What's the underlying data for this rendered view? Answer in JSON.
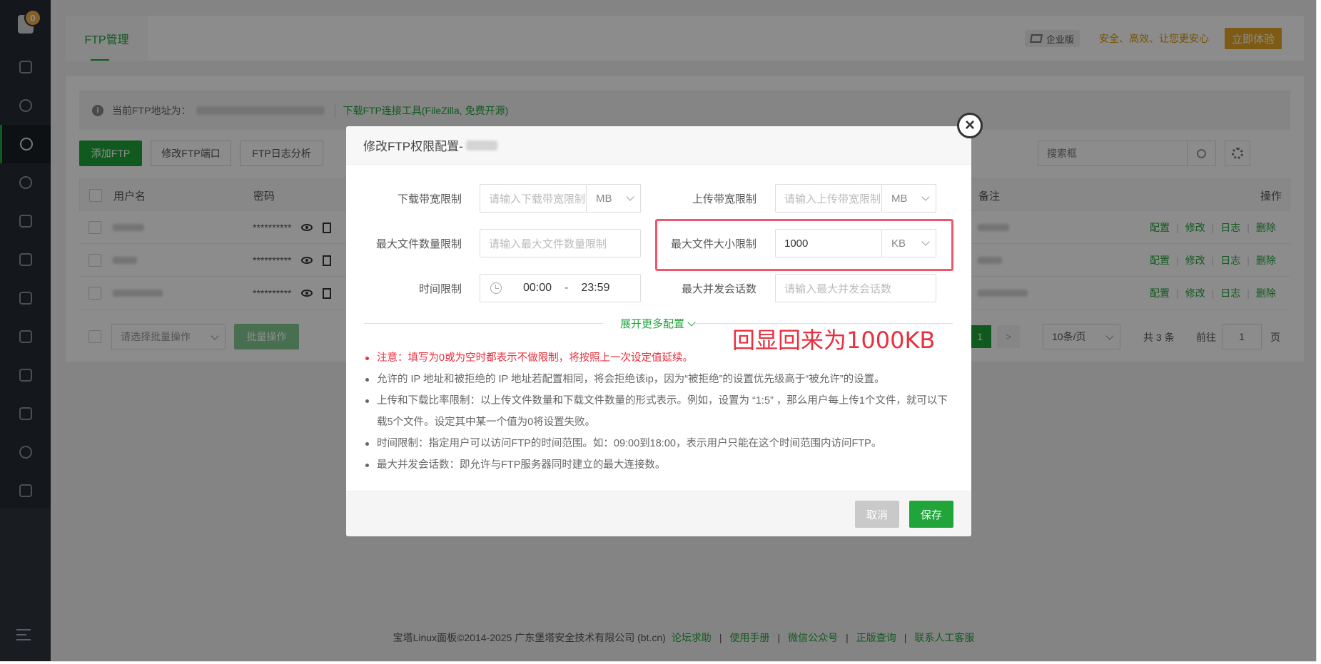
{
  "sidebar": {
    "badge_count": "0",
    "items": [
      {
        "icon": "home-icon"
      },
      {
        "icon": "globe-icon"
      },
      {
        "icon": "ftp-globe-icon",
        "active": true
      },
      {
        "icon": "database-icon"
      },
      {
        "icon": "save-icon"
      },
      {
        "icon": "shield-icon"
      },
      {
        "icon": "folder-icon"
      },
      {
        "icon": "log-icon"
      },
      {
        "icon": "calendar-icon"
      },
      {
        "icon": "apps-icon"
      },
      {
        "icon": "settings-icon"
      },
      {
        "icon": "logout-icon"
      }
    ]
  },
  "header": {
    "tab": "FTP管理",
    "edition": "企业版",
    "slogan": "安全、高效、让您更安心",
    "try_button": "立即体验"
  },
  "info_bar": {
    "label": "当前FTP地址为：",
    "link": "下载FTP连接工具(FileZilla, 免费开源)"
  },
  "toolbar": {
    "add": "添加FTP",
    "port": "修改FTP端口",
    "log": "FTP日志分析",
    "search_placeholder": "搜索框"
  },
  "table": {
    "headers": {
      "user": "用户名",
      "password": "密码",
      "note": "备注",
      "ops": "操作"
    },
    "rows": [
      {
        "password": "**********"
      },
      {
        "password": "**********"
      },
      {
        "password": "**********"
      }
    ],
    "ops": [
      "配置",
      "修改",
      "日志",
      "删除"
    ]
  },
  "batch": {
    "select_placeholder": "请选择批量操作",
    "button": "批量操作"
  },
  "pagination": {
    "current": "1",
    "next": ">",
    "page_size": "10条/页",
    "total": "共 3 条",
    "goto_label": "前往",
    "goto_value": "1",
    "page_suffix": "页"
  },
  "footer": {
    "copyright": "宝塔Linux面板©2014-2025 广东堡塔安全技术有限公司 (bt.cn)",
    "links": [
      "论坛求助",
      "使用手册",
      "微信公众号",
      "正版查询",
      "联系人工客服"
    ],
    "separator": "|"
  },
  "dialog": {
    "title": "修改FTP权限配置-",
    "close_symbol": "×",
    "fields": {
      "download_bw": {
        "label": "下载带宽限制",
        "placeholder": "请输入下载带宽限制",
        "unit": "MB"
      },
      "upload_bw": {
        "label": "上传带宽限制",
        "placeholder": "请输入上传带宽限制",
        "unit": "MB"
      },
      "max_files": {
        "label": "最大文件数量限制",
        "placeholder": "请输入最大文件数量限制"
      },
      "max_file_size": {
        "label": "最大文件大小限制",
        "value": "1000",
        "unit": "KB"
      },
      "time_limit": {
        "label": "时间限制",
        "start": "00:00",
        "sep": "-",
        "end": "23:59"
      },
      "max_sessions": {
        "label": "最大并发会话数",
        "placeholder": "请输入最大并发会话数"
      }
    },
    "expand_label": "展开更多配置",
    "annotation": "回显回来为1000KB",
    "notes": [
      "注意：填写为0或为空时都表示不做限制，将按照上一次设定值延续。",
      "允许的 IP 地址和被拒绝的 IP 地址若配置相同，将会拒绝该ip，因为“被拒绝”的设置优先级高于“被允许”的设置。",
      "上传和下载比率限制：以上传文件数量和下载文件数量的形式表示。例如，设置为 “1:5” ，那么用户每上传1个文件，就可以下载5个文件。设定其中某一个值为0将设置失败。",
      "时间限制：指定用户可以访问FTP的时间范围。如：09:00到18:00，表示用户只能在这个时间范围内访问FTP。",
      "最大并发会话数：即允许与FTP服务器同时建立的最大连接数。"
    ],
    "cancel": "取消",
    "save": "保存"
  },
  "colors": {
    "accent": "#20a53a",
    "sidebar": "#252a33",
    "warning": "#e8303f",
    "highlight_border": "#f0566b",
    "gold": "#e3a626"
  }
}
